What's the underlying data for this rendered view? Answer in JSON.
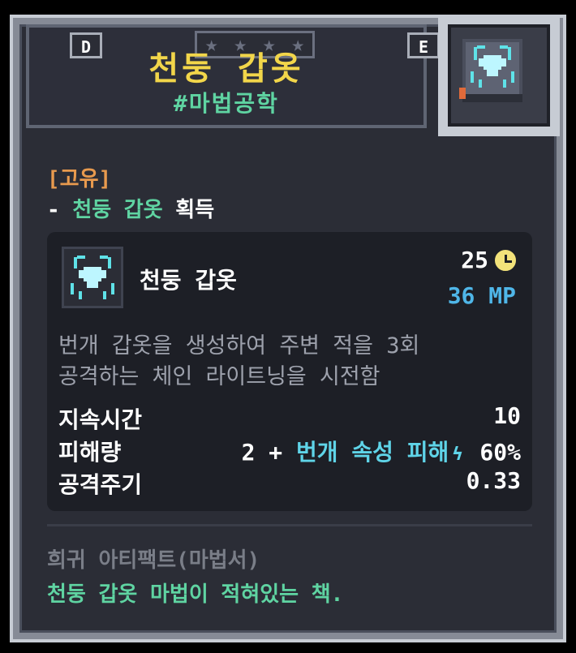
{
  "header": {
    "title": "천둥 갑옷",
    "subtitle": "#마법공학",
    "tag_left": "D",
    "tag_right": "E",
    "stars_count": 4
  },
  "icons": {
    "item": "lightning-armor-book-icon",
    "skill": "lightning-armor-skill-icon",
    "cooldown": "clock-icon",
    "element": "lightning-bolt-icon"
  },
  "body": {
    "unique_label": "[고유]",
    "acquire_prefix": "- ",
    "acquire_highlight": "천둥 갑옷",
    "acquire_suffix": " 획득",
    "skill": {
      "name": "천둥 갑옷",
      "cooldown": "25",
      "mp": "36 MP",
      "description_line1": "번개 갑옷을 생성하여 주변 적을 3회",
      "description_line2": "공격하는 체인 라이트닝을 시전함",
      "stats": [
        {
          "label": "지속시간",
          "value": "10"
        },
        {
          "label": "피해량",
          "value_prefix": "2 + ",
          "value_highlight": "번개 속성 피해",
          "value_suffix": " 60%"
        },
        {
          "label": "공격주기",
          "value": "0.33"
        }
      ]
    },
    "rarity": "희귀 아티팩트(마법서)",
    "lore": "천둥 갑옷 마법이 적혀있는 책."
  },
  "colors": {
    "title": "#f2d64a",
    "tag_green": "#5fd4a2",
    "mp_blue": "#4fb6e8",
    "unique_orange": "#e89a4e"
  }
}
